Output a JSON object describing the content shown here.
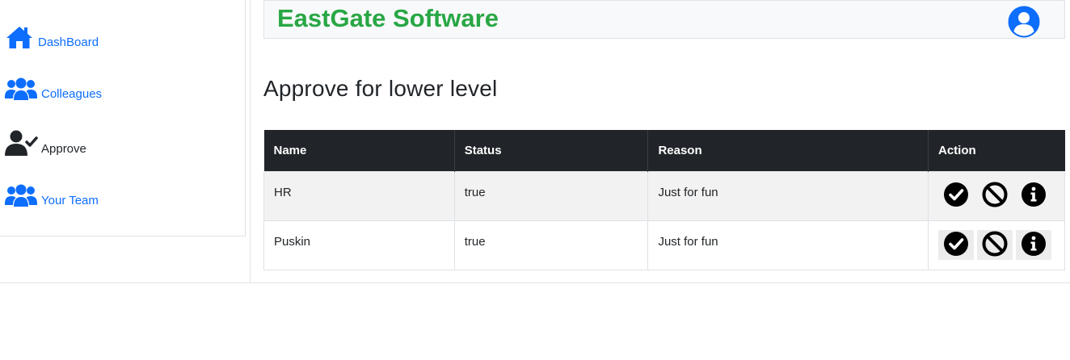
{
  "sidebar": {
    "items": [
      {
        "label": "DashBoard",
        "icon": "home-icon"
      },
      {
        "label": "Colleagues",
        "icon": "users-icon"
      },
      {
        "label": "Approve",
        "icon": "user-check-icon"
      },
      {
        "label": "Your Team",
        "icon": "users-icon"
      }
    ],
    "active_item": "Approve"
  },
  "header": {
    "brand": "EastGate Software",
    "avatar_icon": "user-circle-icon"
  },
  "main": {
    "title": "Approve for lower level",
    "table": {
      "columns": [
        "Name",
        "Status",
        "Reason",
        "Action"
      ],
      "rows": [
        {
          "name": "HR",
          "status": "true",
          "reason": "Just for fun"
        },
        {
          "name": "Puskin",
          "status": "true",
          "reason": "Just for fun"
        }
      ],
      "actions": [
        "approve-icon",
        "reject-icon",
        "info-icon"
      ]
    }
  },
  "colors": {
    "brand": "#28a745",
    "link": "#0d6efd",
    "table_header_bg": "#212529",
    "stripe": "#f2f2f2"
  }
}
